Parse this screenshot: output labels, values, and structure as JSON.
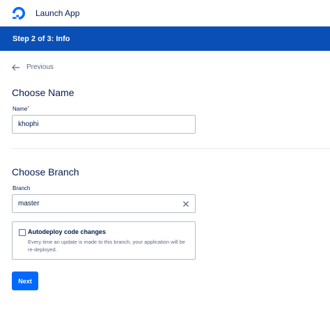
{
  "header": {
    "app_title": "Launch App",
    "logo_icon": "digitalocean-logo-icon"
  },
  "stepbar": {
    "label": "Step 2 of 3: Info",
    "color": "#0a4fb5"
  },
  "nav": {
    "previous_label": "Previous",
    "previous_icon": "arrow-left-icon"
  },
  "name_section": {
    "heading": "Choose Name",
    "label": "Name",
    "required_mark": "*",
    "value": "khophi"
  },
  "branch_section": {
    "heading": "Choose Branch",
    "label": "Branch",
    "value": "master",
    "clear_icon": "close-icon"
  },
  "autodeploy": {
    "checked": false,
    "title": "Autodeploy code changes",
    "description": "Every time an update is made to this branch, your application will be re-deployed."
  },
  "actions": {
    "next_label": "Next",
    "accent_color": "#0069ff"
  }
}
